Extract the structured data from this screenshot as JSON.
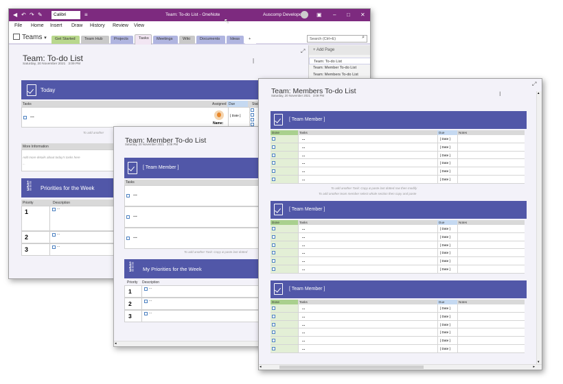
{
  "window": {
    "title": "Team: To-do List - OneNote",
    "user": "Auscomp Developer",
    "font_name": "Calibri"
  },
  "menu": [
    "File",
    "Home",
    "Insert",
    "Draw",
    "History",
    "Review",
    "View"
  ],
  "notebook": {
    "name": "Teams"
  },
  "section_tabs": [
    {
      "label": "Get Started",
      "color": "#b9d88d"
    },
    {
      "label": "Team Hub",
      "color": "#c9c9c9"
    },
    {
      "label": "Projects",
      "color": "#b0b5e0"
    },
    {
      "label": "Tasks",
      "color": "#f2e6f3"
    },
    {
      "label": "Meetings",
      "color": "#b0b5e0"
    },
    {
      "label": "Wiki",
      "color": "#c9c9c9"
    },
    {
      "label": "Documents",
      "color": "#b0b5e0"
    },
    {
      "label": "Ideas",
      "color": "#b0b5e0"
    },
    {
      "label": "+",
      "color": "#ffffff"
    }
  ],
  "search": {
    "placeholder": "Search (Ctrl+E)"
  },
  "pages": {
    "add_label": "+ Add Page",
    "items": [
      "Team: To-do List",
      "Team: Member To-do List",
      "Team: Members To-do List"
    ]
  },
  "main_page": {
    "title": "Team: To-do List",
    "date": "Saturday, 20 November 2021",
    "time": "3:09 PM",
    "today": "Today",
    "headers": {
      "tasks": "Tasks",
      "assigned": "Assigned",
      "due": "Due",
      "status": "Status"
    },
    "task_text": "...",
    "name_label": "Name:",
    "due_value": "[ Date ]",
    "hint": "To add another",
    "more_info": "More Information",
    "more_info_placeholder": "Add more details about today's tasks here",
    "more_info_dots": "...",
    "priorities_title": "Priorities for the Week",
    "priority_headers": {
      "priority": "Priority",
      "description": "Description"
    },
    "priority_nums": [
      "1",
      "2",
      "3"
    ],
    "item_dots": "..."
  },
  "member_page": {
    "title": "Team: Member To-do List",
    "date": "Saturday, 20 November 2021",
    "time": "3:09 PM",
    "band_label": "[ Team Member ]",
    "tasks_header": "Tasks",
    "task_text": "...",
    "hint": "To add another Task: Copy & paste last dotted",
    "priorities_title": "My Priorities for the Week",
    "priority_headers": {
      "priority": "Priority",
      "description": "Description"
    },
    "priority_nums": [
      "1",
      "2",
      "3"
    ],
    "item_dots": "..."
  },
  "members_page": {
    "title": "Team: Members To-do List",
    "date": "Saturday, 20 November 2021",
    "time": "3:09 PM",
    "band_label": "[ Team Member ]",
    "headers": {
      "done": "Done",
      "tasks": "Tasks",
      "due": "Due",
      "notes": "Notes"
    },
    "task_text": "...",
    "due_value": "[ Date ]",
    "hint1": "To add another Task: Copy & paste last dotted row then modify",
    "hint2": "To add another team member select whole section then copy and paste"
  },
  "colors": {
    "title_bar": "#7d2a7f",
    "band": "#5157a8",
    "done_col": "#e3efd6",
    "due_col": "#c5d9f1"
  }
}
